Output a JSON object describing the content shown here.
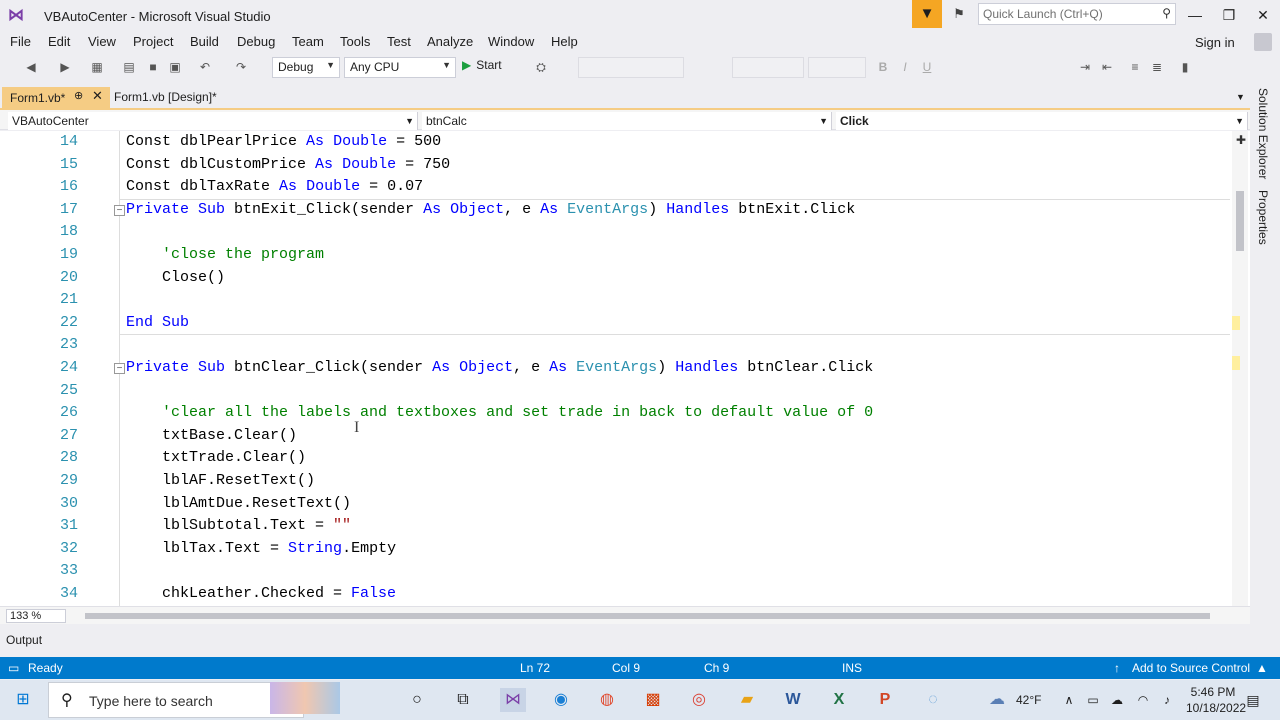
{
  "window": {
    "title": "VBAutoCenter - Microsoft Visual Studio"
  },
  "quick_launch": {
    "placeholder": "Quick Launch (Ctrl+Q)"
  },
  "menu": [
    "File",
    "Edit",
    "View",
    "Project",
    "Build",
    "Debug",
    "Team",
    "Tools",
    "Test",
    "Analyze",
    "Window",
    "Help"
  ],
  "account": {
    "signin": "Sign in"
  },
  "toolbar": {
    "config": "Debug",
    "platform": "Any CPU",
    "start": "Start"
  },
  "tabs": [
    {
      "label": "Form1.vb*"
    },
    {
      "label": "Form1.vb [Design]*"
    }
  ],
  "navbar": {
    "project": "VBAutoCenter",
    "object": "btnCalc",
    "event": "Click"
  },
  "code_lines": [
    {
      "n": "14",
      "tokens": [
        [
          "pl",
          "    Const dblPearlPrice "
        ],
        [
          "kw",
          "As"
        ],
        [
          "pl",
          " "
        ],
        [
          "kw",
          "Double"
        ],
        [
          "pl",
          " = 500"
        ]
      ]
    },
    {
      "n": "15",
      "tokens": [
        [
          "pl",
          "    Const dblCustomPrice "
        ],
        [
          "kw",
          "As"
        ],
        [
          "pl",
          " "
        ],
        [
          "kw",
          "Double"
        ],
        [
          "pl",
          " = 750"
        ]
      ]
    },
    {
      "n": "16",
      "tokens": [
        [
          "pl",
          "    Const dblTaxRate "
        ],
        [
          "kw",
          "As"
        ],
        [
          "pl",
          " "
        ],
        [
          "kw",
          "Double"
        ],
        [
          "pl",
          " = 0.07"
        ]
      ]
    },
    {
      "n": "17",
      "tokens": [
        [
          "kw",
          "    Private Sub"
        ],
        [
          "pl",
          " btnExit_Click(sender "
        ],
        [
          "kw",
          "As"
        ],
        [
          "pl",
          " "
        ],
        [
          "kw",
          "Object"
        ],
        [
          "pl",
          ", e "
        ],
        [
          "kw",
          "As"
        ],
        [
          "pl",
          " "
        ],
        [
          "ty",
          "EventArgs"
        ],
        [
          "pl",
          ") "
        ],
        [
          "kw",
          "Handles"
        ],
        [
          "pl",
          " btnExit.Click"
        ]
      ],
      "collapse": true,
      "sep_before": true
    },
    {
      "n": "18",
      "tokens": []
    },
    {
      "n": "19",
      "tokens": [
        [
          "cm",
          "        'close the program"
        ]
      ]
    },
    {
      "n": "20",
      "tokens": [
        [
          "pl",
          "        Close()"
        ]
      ]
    },
    {
      "n": "21",
      "tokens": []
    },
    {
      "n": "22",
      "tokens": [
        [
          "kw",
          "    End Sub"
        ]
      ]
    },
    {
      "n": "23",
      "tokens": [],
      "sep_before": true
    },
    {
      "n": "24",
      "tokens": [
        [
          "kw",
          "    Private Sub"
        ],
        [
          "pl",
          " btnClear_Click(sender "
        ],
        [
          "kw",
          "As"
        ],
        [
          "pl",
          " "
        ],
        [
          "kw",
          "Object"
        ],
        [
          "pl",
          ", e "
        ],
        [
          "kw",
          "As"
        ],
        [
          "pl",
          " "
        ],
        [
          "ty",
          "EventArgs"
        ],
        [
          "pl",
          ") "
        ],
        [
          "kw",
          "Handles"
        ],
        [
          "pl",
          " btnClear.Click"
        ]
      ],
      "collapse": true
    },
    {
      "n": "25",
      "tokens": []
    },
    {
      "n": "26",
      "tokens": [
        [
          "cm",
          "        'clear all the labels and textboxes and set trade in back to default value of 0"
        ]
      ]
    },
    {
      "n": "27",
      "tokens": [
        [
          "pl",
          "        txtBase.Clear()"
        ]
      ]
    },
    {
      "n": "28",
      "tokens": [
        [
          "pl",
          "        txtTrade.Clear()"
        ]
      ]
    },
    {
      "n": "29",
      "tokens": [
        [
          "pl",
          "        lblAF.ResetText()"
        ]
      ]
    },
    {
      "n": "30",
      "tokens": [
        [
          "pl",
          "        lblAmtDue.ResetText()"
        ]
      ]
    },
    {
      "n": "31",
      "tokens": [
        [
          "pl",
          "        lblSubtotal.Text = "
        ],
        [
          "st",
          "\"\""
        ]
      ]
    },
    {
      "n": "32",
      "tokens": [
        [
          "pl",
          "        lblTax.Text = "
        ],
        [
          "kw",
          "String"
        ],
        [
          "pl",
          ".Empty"
        ]
      ]
    },
    {
      "n": "33",
      "tokens": []
    },
    {
      "n": "34",
      "tokens": [
        [
          "pl",
          "        chkLeather.Checked = "
        ],
        [
          "kw",
          "False"
        ]
      ]
    }
  ],
  "zoom": "133 %",
  "side_panels": [
    "Solution Explorer",
    "Properties"
  ],
  "output_label": "Output",
  "status": {
    "ready": "Ready",
    "line": "Ln 72",
    "col": "Col 9",
    "ch": "Ch 9",
    "mode": "INS",
    "source_control": "Add to Source Control"
  },
  "taskbar": {
    "search_placeholder": "Type here to search",
    "temperature": "42°F",
    "time": "5:46 PM",
    "date": "10/18/2022"
  },
  "colors": {
    "accent": "#007acc",
    "tab_active": "#f5cc84",
    "keyword": "#0000ff",
    "type": "#2b91af",
    "comment": "#008000"
  }
}
